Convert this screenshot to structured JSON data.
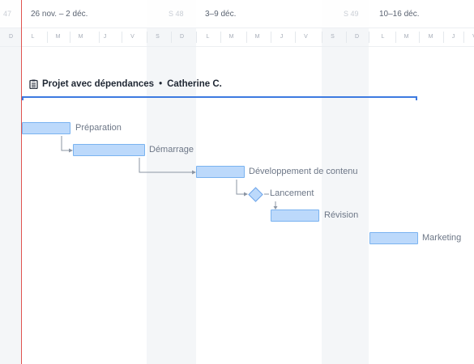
{
  "weeks": [
    {
      "label": "26 nov. – 2 déc.",
      "num": "S 48"
    },
    {
      "label": "3–9 déc.",
      "num": "S 49"
    },
    {
      "label": "10–16 déc.",
      "num": ""
    }
  ],
  "partial_week_num": "47",
  "days": [
    "D",
    "L",
    "M",
    "M",
    "J",
    "V",
    "S",
    "D",
    "L",
    "M",
    "M",
    "J",
    "V",
    "S",
    "D",
    "L",
    "M",
    "M",
    "J",
    "V"
  ],
  "project": {
    "title": "Projet avec dépendances",
    "separator": "•",
    "owner": "Catherine C."
  },
  "tasks": [
    {
      "label": "Préparation"
    },
    {
      "label": "Démarrage"
    },
    {
      "label": "Développement de contenu"
    },
    {
      "label": "Lancement"
    },
    {
      "label": "Révision"
    },
    {
      "label": "Marketing"
    }
  ],
  "colors": {
    "accent": "#3d7ae0",
    "bar_fill": "#bcd9fb",
    "bar_border": "#7ab3f0",
    "today": "#e0534f"
  }
}
